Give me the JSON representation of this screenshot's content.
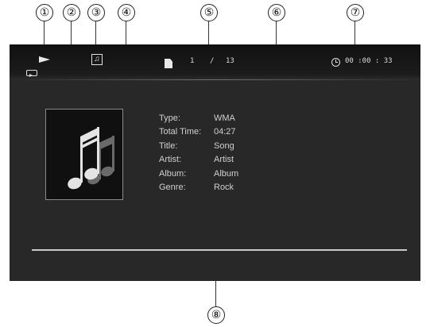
{
  "callouts": [
    "①",
    "②",
    "③",
    "④",
    "⑤",
    "⑥",
    "⑦",
    "⑧"
  ],
  "status_bar": {
    "play_icon": "play-icon",
    "repeat_icon": "repeat-icon",
    "mode_icon": "music-note-icon",
    "file_icon": "file-icon",
    "current_track": "1",
    "separator": "/",
    "total_tracks": "13",
    "clock_icon": "clock-icon",
    "elapsed_time": "00 :00 : 33"
  },
  "album_art": {
    "icon": "music-notes-icon"
  },
  "info": [
    {
      "label": "Type:",
      "value": "WMA"
    },
    {
      "label": "Total Time:",
      "value": "04:27"
    },
    {
      "label": "Title:",
      "value": "Song"
    },
    {
      "label": "Artist:",
      "value": "Artist"
    },
    {
      "label": "Album:",
      "value": "Album"
    },
    {
      "label": "Genre:",
      "value": "Rock"
    }
  ],
  "progress": {
    "fraction": 0
  },
  "colors": {
    "screen_bg": "#282828",
    "topbar_bg": "#111111",
    "text": "#d0d0d0"
  }
}
